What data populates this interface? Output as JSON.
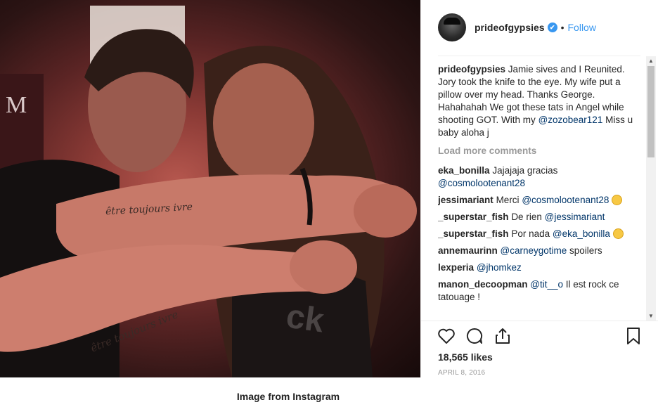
{
  "post": {
    "username": "prideofgypsies",
    "verified_mark": "✔",
    "separator": "•",
    "follow_label": "Follow"
  },
  "caption": {
    "username": "prideofgypsies",
    "text": "Jamie sives and I Reunited. Jory took the knife to the eye. My wife put a pillow over my head. Thanks George. Hahahahah We got these tats in Angel while shooting GOT. With my",
    "mention": "@zozobear121",
    "tail": "Miss u baby aloha j"
  },
  "load_more": "Load more comments",
  "comments": [
    {
      "user": "eka_bonilla",
      "text": "Jajajaja gracias",
      "mention": "@cosmolootenant28",
      "after": "",
      "emoji": false
    },
    {
      "user": "jessimariant",
      "text": "Merci",
      "mention": "@cosmolootenant28",
      "after": "",
      "emoji": true
    },
    {
      "user": "_superstar_fish",
      "text": "De rien",
      "mention": "@jessimariant",
      "after": "",
      "emoji": false
    },
    {
      "user": "_superstar_fish",
      "text": "Por nada",
      "mention": "@eka_bonilla",
      "after": "",
      "emoji": true
    },
    {
      "user": "annemaurinn",
      "text": "",
      "mention": "@carneygotime",
      "after": "spoilers",
      "emoji": false
    },
    {
      "user": "lexperia",
      "text": "",
      "mention": "@jhomkez",
      "after": "",
      "emoji": false
    },
    {
      "user": "manon_decoopman",
      "text": "",
      "mention": "@tit__o",
      "after": "Il est rock ce tatouage !",
      "emoji": false
    }
  ],
  "icons": {
    "like": "heart-icon",
    "comment": "comment-icon",
    "share": "share-icon",
    "save": "bookmark-icon"
  },
  "likes": "18,565 likes",
  "date": "APRIL 8, 2016",
  "footer": "Image from Instagram",
  "colors": {
    "link_blue": "#3897f0",
    "mention_blue": "#003569",
    "muted": "#999999"
  }
}
